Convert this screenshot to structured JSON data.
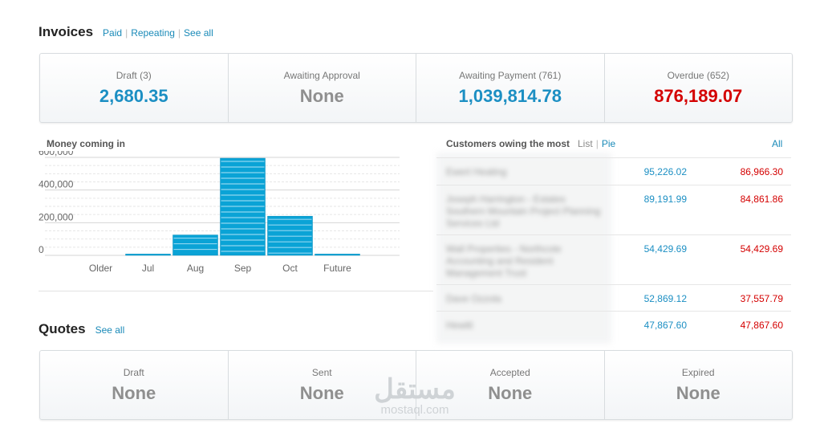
{
  "invoices": {
    "title": "Invoices",
    "links": [
      "Paid",
      "Repeating",
      "See all"
    ],
    "cards": [
      {
        "label": "Draft (3)",
        "value": "2,680.35",
        "tone": "blue"
      },
      {
        "label": "Awaiting Approval",
        "value": "None",
        "tone": "grey"
      },
      {
        "label": "Awaiting Payment (761)",
        "value": "1,039,814.78",
        "tone": "blue"
      },
      {
        "label": "Overdue (652)",
        "value": "876,189.07",
        "tone": "red"
      }
    ]
  },
  "money_in": {
    "title": "Money coming in"
  },
  "chart_data": {
    "type": "bar",
    "categories": [
      "Older",
      "Jul",
      "Aug",
      "Sep",
      "Oct",
      "Future"
    ],
    "values": [
      0,
      8000,
      125000,
      595000,
      240000,
      8000
    ],
    "ytick_labels": [
      "600,000",
      "400,000",
      "200,000",
      "0"
    ],
    "yticks": [
      600000,
      400000,
      200000,
      0
    ],
    "ylim": [
      0,
      600000
    ],
    "grid": true,
    "colors": {
      "bar": "#0aa3d6",
      "bar_light": "#8fd6f0"
    }
  },
  "customers": {
    "title": "Customers owing the most",
    "view_links": [
      "List",
      "Pie"
    ],
    "all_label": "All",
    "rows": [
      {
        "name": "Ewert Heating",
        "outstanding": "95,226.02",
        "overdue": "86,966.30"
      },
      {
        "name": "Joseph Harrington - Estates Southern Mountain Project Planning Services Ltd",
        "outstanding": "89,191.99",
        "overdue": "84,861.86"
      },
      {
        "name": "Wall Properties - Northcote Accounting and Resident Management Trust",
        "outstanding": "54,429.69",
        "overdue": "54,429.69"
      },
      {
        "name": "Dave Ozzola",
        "outstanding": "52,869.12",
        "overdue": "37,557.79"
      },
      {
        "name": "Hewitt",
        "outstanding": "47,867.60",
        "overdue": "47,867.60"
      }
    ]
  },
  "quotes": {
    "title": "Quotes",
    "links": [
      "See all"
    ],
    "cards": [
      {
        "label": "Draft",
        "value": "None",
        "tone": "grey"
      },
      {
        "label": "Sent",
        "value": "None",
        "tone": "grey"
      },
      {
        "label": "Accepted",
        "value": "None",
        "tone": "grey"
      },
      {
        "label": "Expired",
        "value": "None",
        "tone": "grey"
      }
    ]
  },
  "watermark": {
    "arabic": "مستقل",
    "latin": "mostaql.com"
  }
}
